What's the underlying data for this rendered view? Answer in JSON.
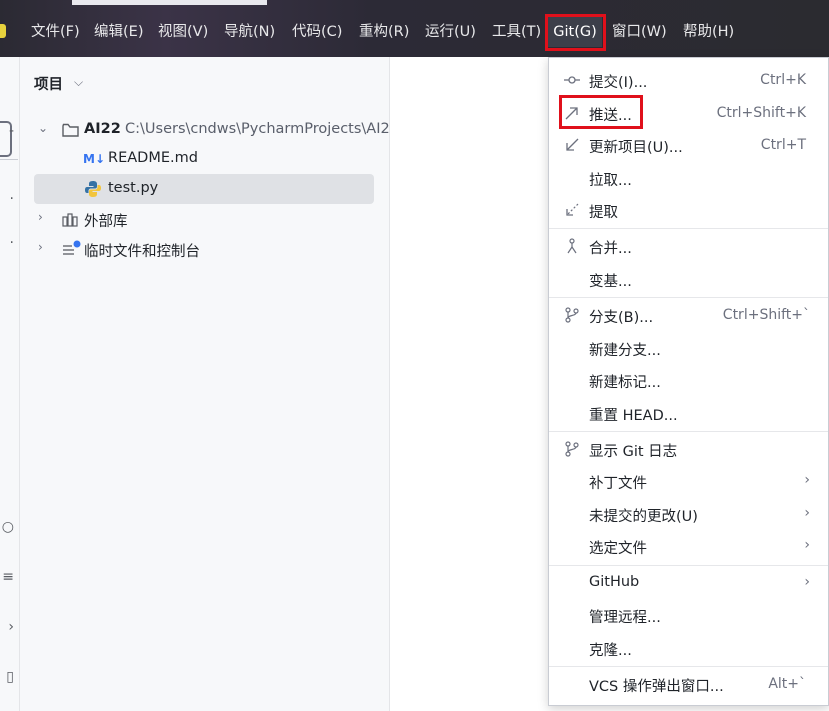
{
  "menubar": {
    "items": [
      {
        "label": "文件(F)"
      },
      {
        "label": "编辑(E)"
      },
      {
        "label": "视图(V)"
      },
      {
        "label": "导航(N)"
      },
      {
        "label": "代码(C)"
      },
      {
        "label": "重构(R)"
      },
      {
        "label": "运行(U)"
      },
      {
        "label": "工具(T)"
      },
      {
        "label": "Git(G)"
      },
      {
        "label": "窗口(W)"
      },
      {
        "label": "帮助(H)"
      }
    ]
  },
  "project_panel": {
    "title": "项目",
    "root": {
      "name": "AI22",
      "path": "C:\\Users\\cndws\\PycharmProjects\\AI2"
    },
    "files": [
      {
        "icon_text": "M↓",
        "name": "README.md"
      },
      {
        "name": "test.py"
      }
    ],
    "external_libraries": "外部库",
    "scratches": "临时文件和控制台"
  },
  "git_menu": {
    "items": [
      {
        "label": "提交(I)...",
        "shortcut": "Ctrl+K"
      },
      {
        "label": "推送...",
        "shortcut": "Ctrl+Shift+K"
      },
      {
        "label": "更新项目(U)...",
        "shortcut": "Ctrl+T"
      },
      {
        "label": "拉取..."
      },
      {
        "label": "提取"
      },
      {
        "label": "合并..."
      },
      {
        "label": "变基..."
      },
      {
        "label": "分支(B)...",
        "shortcut": "Ctrl+Shift+`"
      },
      {
        "label": "新建分支..."
      },
      {
        "label": "新建标记..."
      },
      {
        "label": "重置 HEAD..."
      },
      {
        "label": "显示 Git 日志"
      },
      {
        "label": "补丁文件"
      },
      {
        "label": "未提交的更改(U)"
      },
      {
        "label": "选定文件"
      },
      {
        "label": "GitHub"
      },
      {
        "label": "管理远程..."
      },
      {
        "label": "克隆..."
      },
      {
        "label": "VCS 操作弹出窗口...",
        "shortcut": "Alt+`"
      }
    ]
  },
  "colors": {
    "highlight_border": "#e0101b",
    "menubar_bg": "#2b2a33"
  }
}
